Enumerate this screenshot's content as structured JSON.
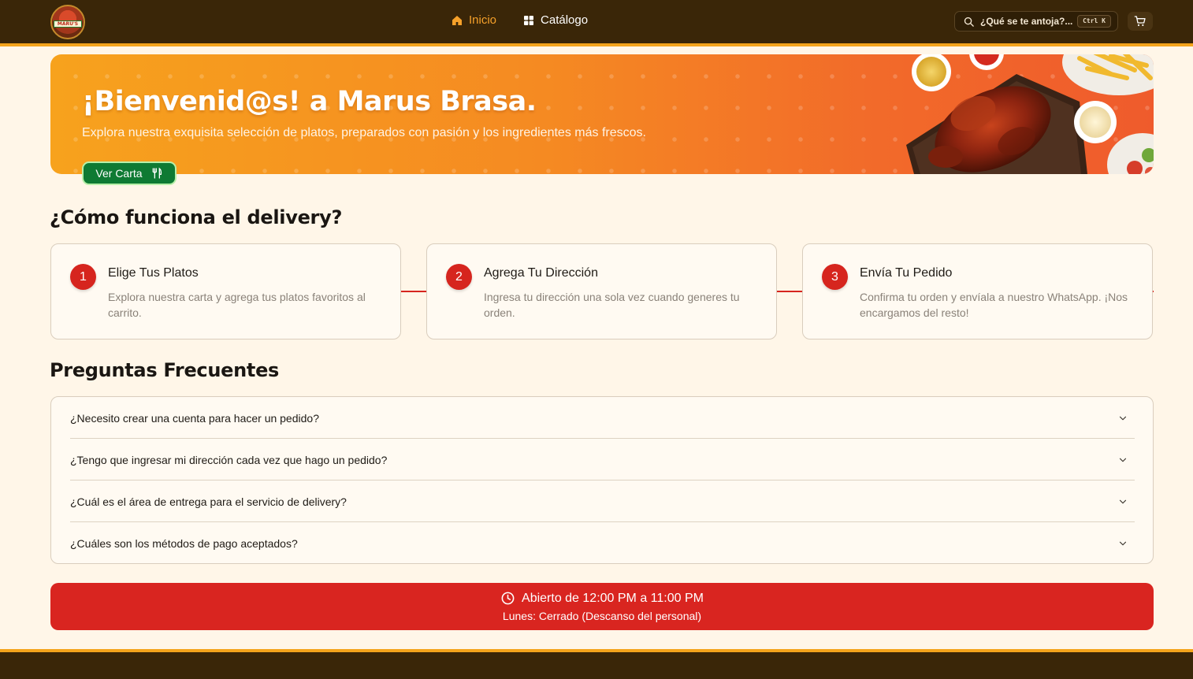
{
  "header": {
    "logo_text": "MARU'S",
    "nav": [
      {
        "label": "Inicio",
        "icon": "home-icon",
        "active": true
      },
      {
        "label": "Catálogo",
        "icon": "grid-icon",
        "active": false
      }
    ],
    "search": {
      "placeholder": "¿Qué se te antoja?...",
      "shortcut": "Ctrl K"
    },
    "cart_icon": "cart-icon"
  },
  "hero": {
    "title": "¡Bienvenid@s! a Marus Brasa.",
    "subtitle": "Explora nuestra exquisita selección de platos, preparados con pasión y los ingredientes más frescos.",
    "cta_label": "Ver Carta",
    "cta_icon": "utensils-icon"
  },
  "delivery": {
    "title": "¿Cómo funciona el delivery?",
    "steps": [
      {
        "number": "1",
        "title": "Elige Tus Platos",
        "description": "Explora nuestra carta y agrega tus platos favoritos al carrito."
      },
      {
        "number": "2",
        "title": "Agrega Tu Dirección",
        "description": "Ingresa tu dirección una sola vez cuando generes tu orden."
      },
      {
        "number": "3",
        "title": "Envía Tu Pedido",
        "description": "Confirma tu orden y envíala a nuestro WhatsApp. ¡Nos encargamos del resto!"
      }
    ]
  },
  "faq": {
    "title": "Preguntas Frecuentes",
    "items": [
      {
        "question": "¿Necesito crear una cuenta para hacer un pedido?"
      },
      {
        "question": "¿Tengo que ingresar mi dirección cada vez que hago un pedido?"
      },
      {
        "question": "¿Cuál es el área de entrega para el servicio de delivery?"
      },
      {
        "question": "¿Cuáles son los métodos de pago aceptados?"
      }
    ]
  },
  "hours": {
    "main": "Abierto de 12:00 PM a 11:00 PM",
    "sub": "Lunes: Cerrado (Descanso del personal)"
  },
  "colors": {
    "header_bg": "#3a2608",
    "accent_orange": "#f4a41c",
    "brand_red": "#d92520",
    "cta_green": "#0e7a33",
    "page_bg": "#fff6e8"
  }
}
